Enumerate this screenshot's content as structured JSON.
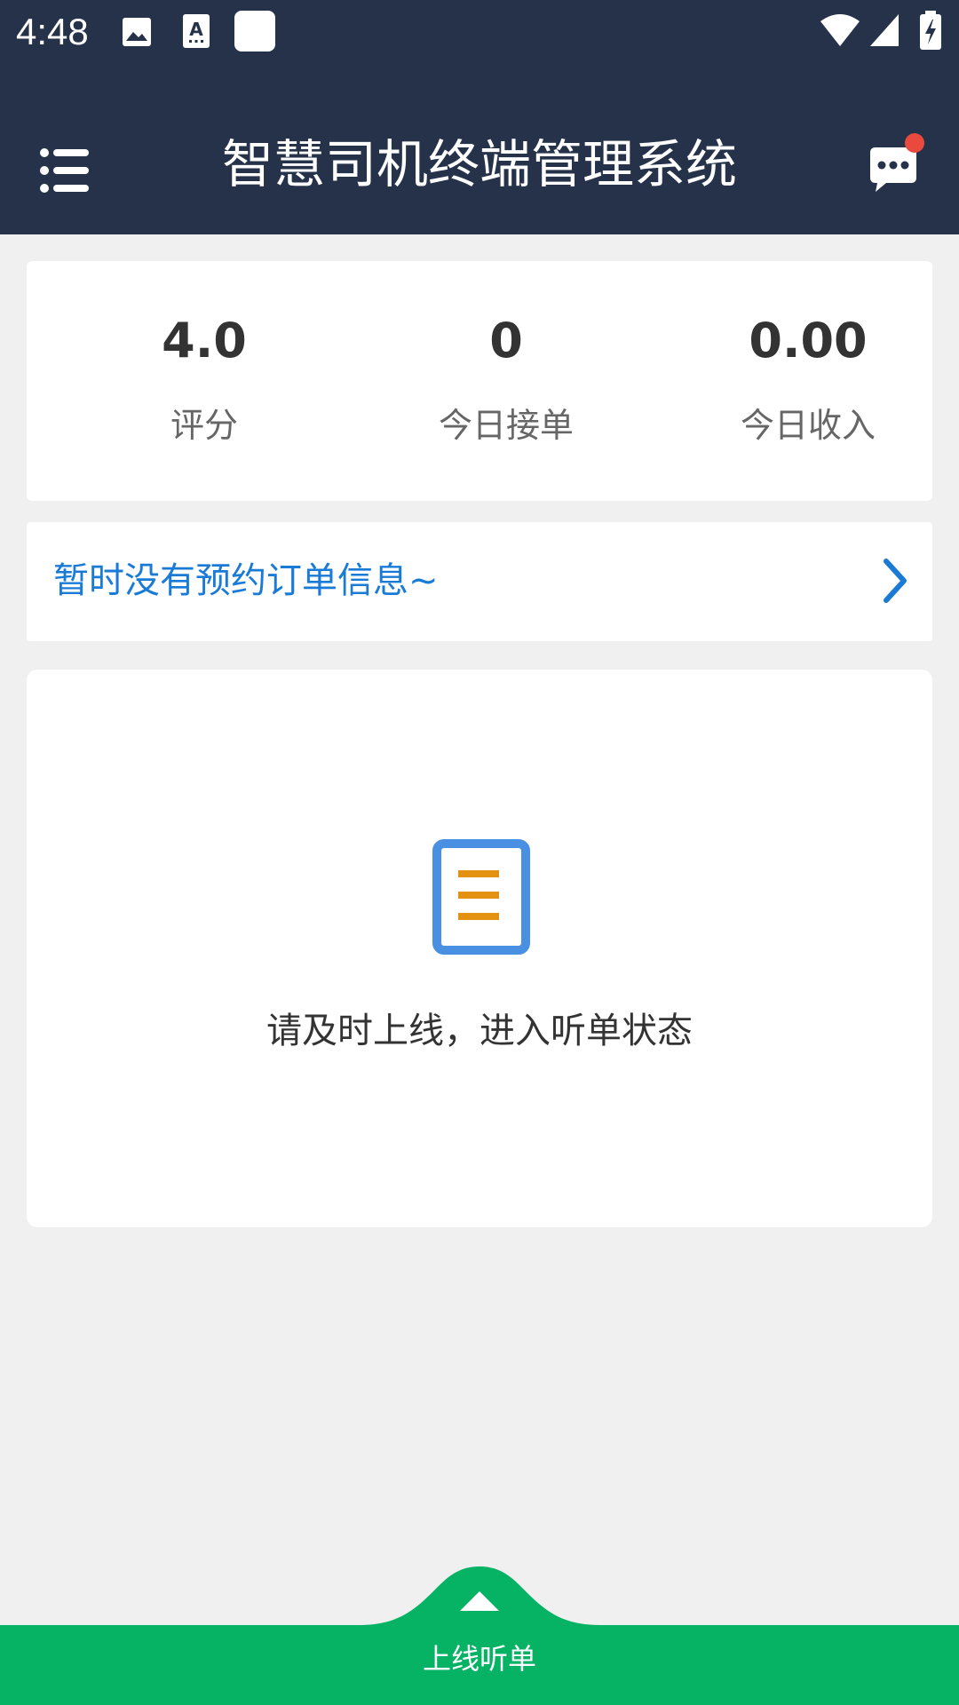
{
  "status_bar": {
    "time": "4:48",
    "icons": [
      "image-icon",
      "text-a-icon",
      "app-square-icon",
      "wifi-icon",
      "signal-icon",
      "battery-charging-icon"
    ]
  },
  "header": {
    "title": "智慧司机终端管理系统",
    "menu_icon": "menu-list-icon",
    "message_icon": "chat-bubble-icon",
    "has_unread": true,
    "accent_color": "#25324a"
  },
  "stats": [
    {
      "value": "4.0",
      "label": "评分"
    },
    {
      "value": "0",
      "label": "今日接单"
    },
    {
      "value": "0.00",
      "label": "今日收入"
    }
  ],
  "order_notice": {
    "text": "暂时没有预约订单信息~",
    "color": "#1a7bd6"
  },
  "empty_state": {
    "icon": "document-list-icon",
    "message": "请及时上线，进入听单状态"
  },
  "bottom_action": {
    "label": "上线听单",
    "color": "#06b264"
  }
}
